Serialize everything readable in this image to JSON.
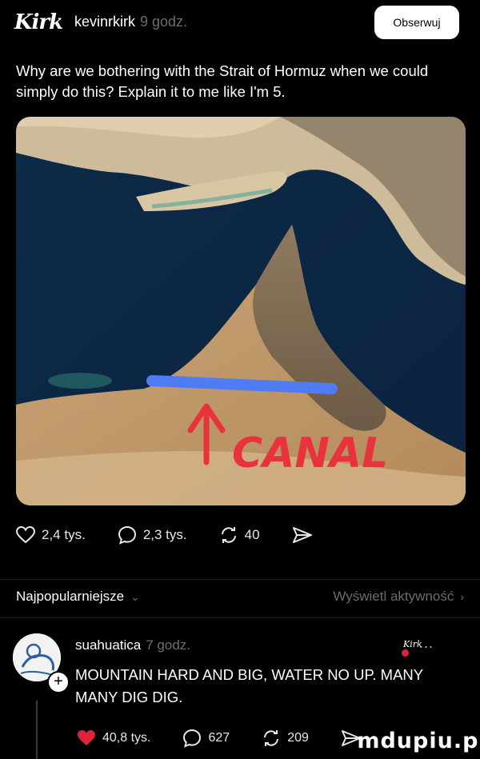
{
  "header": {
    "avatar_text": "Kirk",
    "username": "kevinrkirk",
    "time": "9 godz.",
    "follow_label": "Obserwuj"
  },
  "post": {
    "text": "Why are we bothering with the Strait of Hormuz when we could simply do this? Explain it to me like I'm 5.",
    "image_annotation": "CANAL"
  },
  "actions": {
    "likes": "2,4 tys.",
    "comments": "2,3 tys.",
    "reposts": "40",
    "icons": [
      "heart-icon",
      "comment-icon",
      "repost-icon",
      "share-icon"
    ]
  },
  "sort": {
    "label": "Najpopularniejsze",
    "activity_link": "Wyświetl aktywność"
  },
  "comment": {
    "username": "suahuatica",
    "time": "7 godz.",
    "text": "MOUNTAIN HARD AND BIG, WATER NO UP. MANY MANY DIG DIG.",
    "likes": "40,8 tys.",
    "replies": "627",
    "reposts": "209",
    "more": "...",
    "liked_by_author_badge": "Kirk"
  },
  "watermark": "mdupiu.pl",
  "colors": {
    "background": "#000000",
    "muted": "#6d6d6d",
    "like_red": "#e0233b",
    "canal_blue": "#4f7cf5",
    "annotation_red": "#e8323c"
  }
}
